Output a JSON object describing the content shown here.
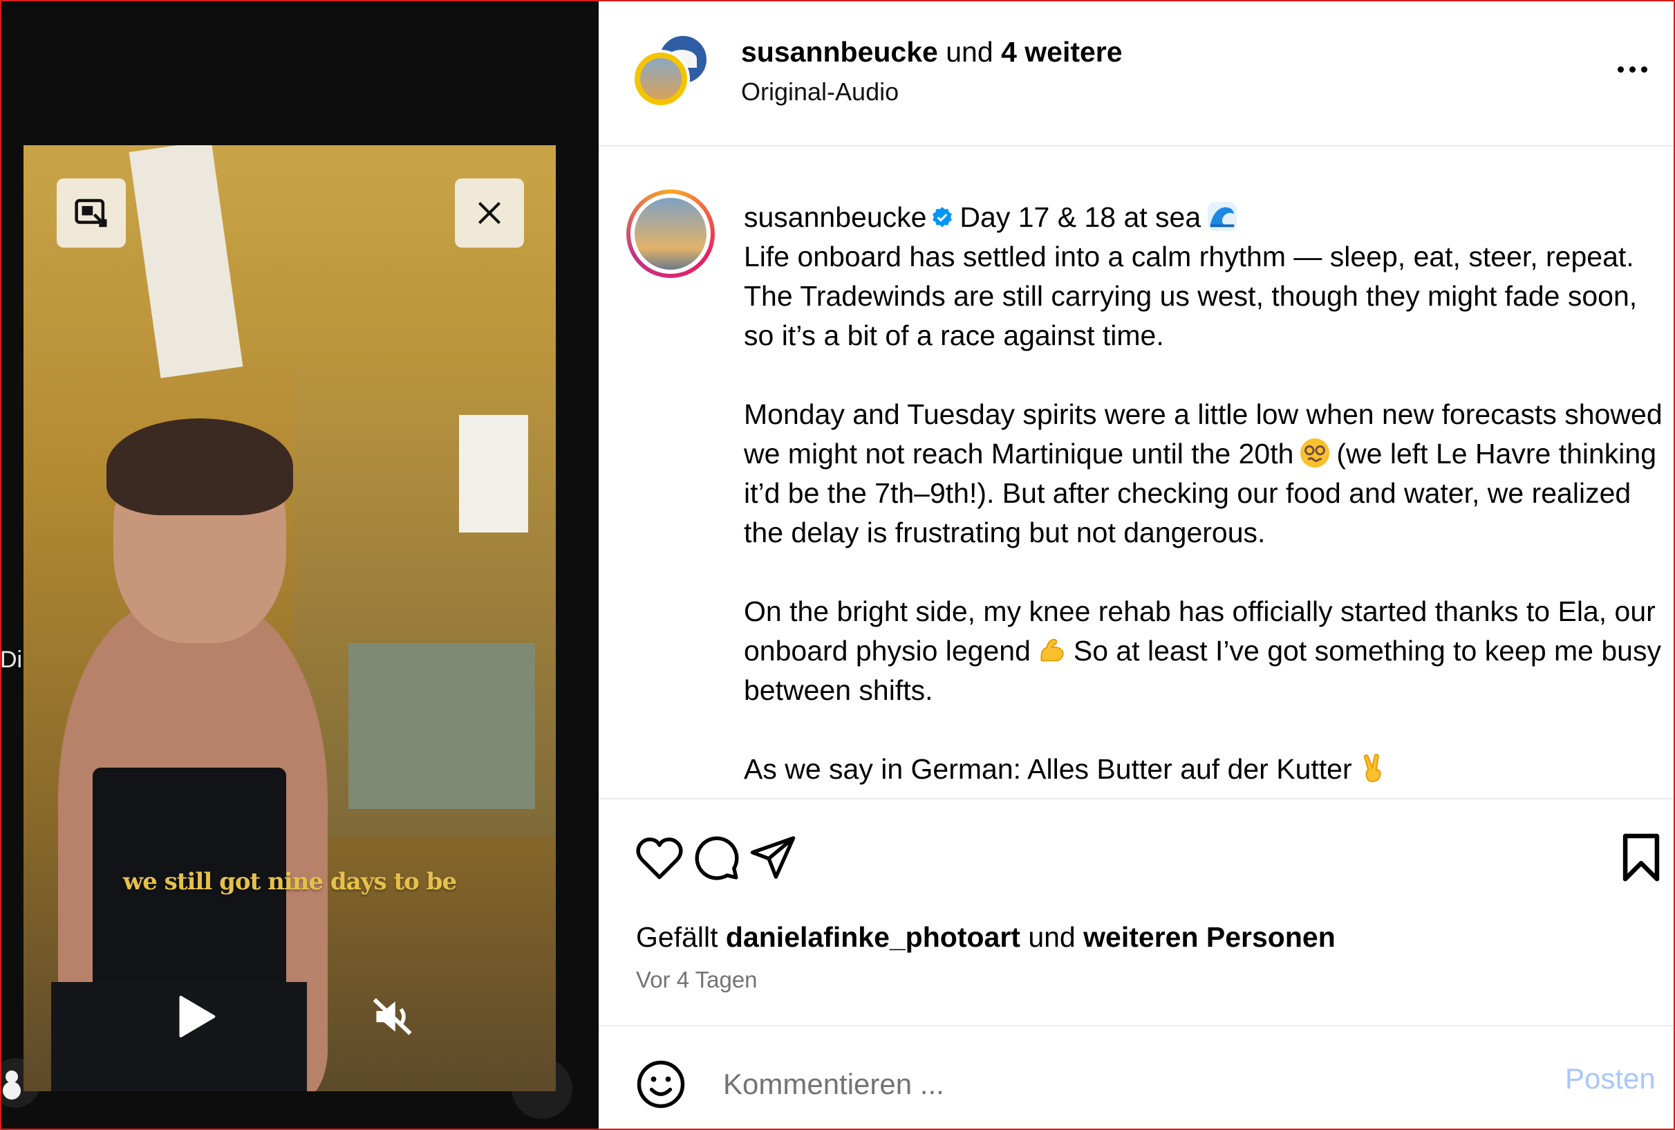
{
  "media": {
    "edge_text": "Di",
    "video_caption": "we still got nine days to be"
  },
  "header": {
    "username": "susannbeucke",
    "connector": "und",
    "others": "4 weitere",
    "audio": "Original-Audio"
  },
  "post_caption": {
    "username": "susannbeucke",
    "title": "Day 17 & 18 at sea",
    "paragraph1": "Life onboard has settled into a calm rhythm — sleep, eat, steer, repeat. The Tradewinds are still carrying us west, though they might fade soon, so it’s a bit of a race against time.",
    "paragraph2_a": "Monday and Tuesday spirits were a little low when new forecasts showed we might not reach Martinique until the 20th",
    "paragraph2_b": "(we left Le Havre thinking it’d be the 7th–9th!). But after checking our food and water, we realized the delay is frustrating but not dangerous.",
    "paragraph3_a": "On the bright side, my knee rehab has officially started thanks to Ela, our onboard physio legend",
    "paragraph3_b": "So at least I’ve got something to keep me busy between shifts.",
    "paragraph4": "As we say in German: Alles Butter auf der Kutter"
  },
  "icons": {
    "verified": "verified-badge-icon",
    "wave": "water-wave-emoji",
    "dizzy": "woozy-face-emoji",
    "muscle": "flexed-biceps-emoji",
    "victory": "victory-hand-emoji"
  },
  "engagement": {
    "likes_prefix": "Gefällt",
    "liked_by": "danielafinke_photoart",
    "likes_connector": "und",
    "likes_rest": "weiteren Personen",
    "time_ago": "Vor 4 Tagen"
  },
  "comment": {
    "placeholder": "Kommentieren ...",
    "post_label": "Posten"
  },
  "colors": {
    "verified": "#0095f6",
    "post_button": "#a8c7fa",
    "secondary_text": "#737373",
    "video_caption": "#e5c14a",
    "frame": "#d81b1b"
  }
}
